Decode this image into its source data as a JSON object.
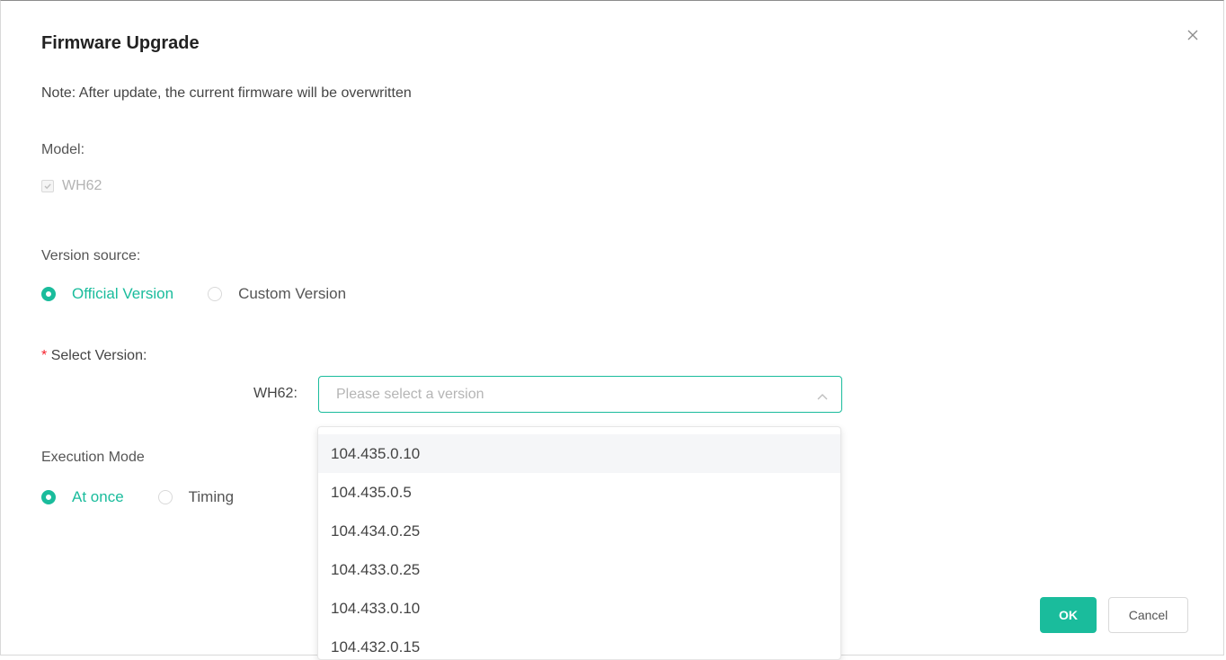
{
  "dialog": {
    "title": "Firmware Upgrade",
    "note": "Note: After update, the current firmware will be overwritten"
  },
  "model": {
    "label": "Model:",
    "checkbox_label": "WH62",
    "checked": true,
    "disabled": true
  },
  "version_source": {
    "label": "Version source:",
    "options": [
      {
        "label": "Official Version",
        "selected": true
      },
      {
        "label": "Custom Version",
        "selected": false
      }
    ]
  },
  "select_version": {
    "required_mark": "*",
    "label": "Select Version:",
    "field_label": "WH62:",
    "placeholder": "Please select a version",
    "options": [
      "104.435.0.10",
      "104.435.0.5",
      "104.434.0.25",
      "104.433.0.25",
      "104.433.0.10",
      "104.432.0.15"
    ],
    "hovered_option": "104.435.0.10"
  },
  "execution_mode": {
    "label": "Execution Mode",
    "options": [
      {
        "label": "At once",
        "selected": true
      },
      {
        "label": "Timing",
        "selected": false
      }
    ]
  },
  "buttons": {
    "ok": "OK",
    "cancel": "Cancel"
  },
  "colors": {
    "accent": "#1abc9c",
    "required": "#f5222d"
  }
}
